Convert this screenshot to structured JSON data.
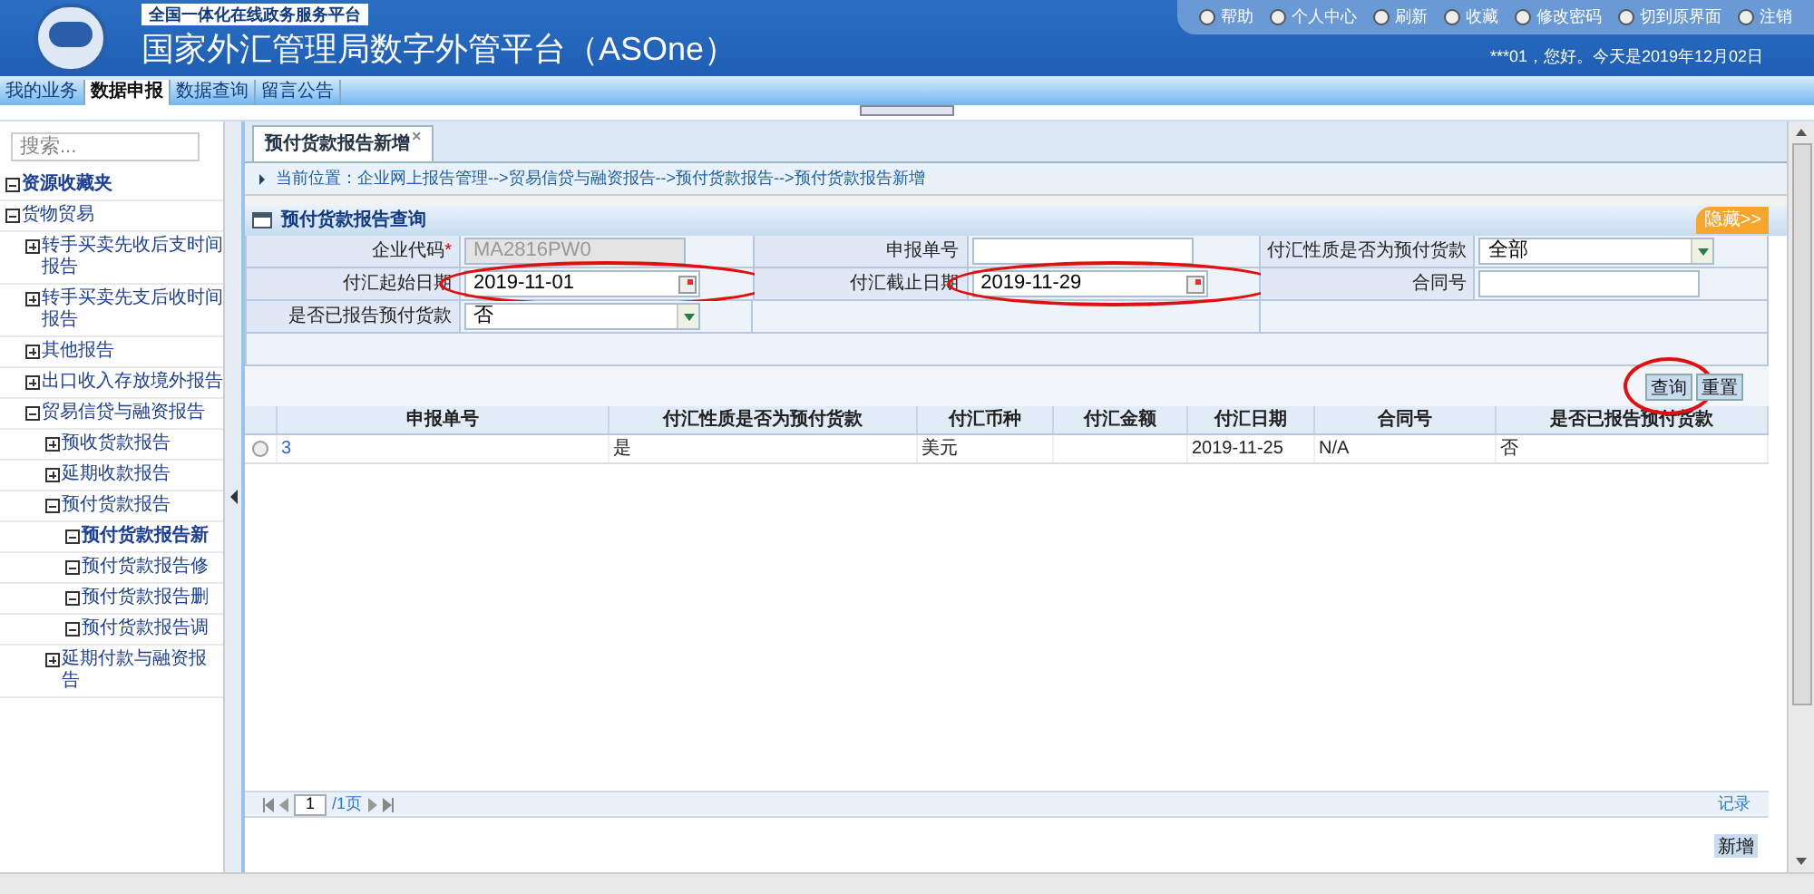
{
  "header": {
    "tagline": "全国一体化在线政务服务平台",
    "title": "国家外汇管理局数字外管平台（ASOne）",
    "links": [
      "帮助",
      "个人中心",
      "刷新",
      "收藏",
      "修改密码",
      "切到原界面",
      "注销"
    ],
    "greeting": "***01，您好。今天是2019年12月02日"
  },
  "menu": [
    {
      "label": "我的业务",
      "selected": false
    },
    {
      "label": "数据申报",
      "selected": true
    },
    {
      "label": "数据查询",
      "selected": false
    },
    {
      "label": "留言公告",
      "selected": false
    }
  ],
  "sidebar": {
    "search": {
      "placeholder": "搜索..."
    },
    "tree": [
      {
        "label": "资源收藏夹",
        "expanded": true,
        "bold": true
      },
      {
        "label": "货物贸易",
        "expanded": true,
        "children": [
          {
            "label": "转手买卖先收后支时间报告",
            "expanded": false
          },
          {
            "label": "转手买卖先支后收时间报告",
            "expanded": false
          },
          {
            "label": "其他报告",
            "expanded": false
          },
          {
            "label": "出口收入存放境外报告",
            "expanded": false
          },
          {
            "label": "贸易信贷与融资报告",
            "expanded": true,
            "children": [
              {
                "label": "预收货款报告",
                "expanded": false
              },
              {
                "label": "延期收款报告",
                "expanded": false
              },
              {
                "label": "预付货款报告",
                "expanded": true,
                "children": [
                  {
                    "label": "预付货款报告新",
                    "expanded": true,
                    "bold": true
                  },
                  {
                    "label": "预付货款报告修",
                    "expanded": true
                  },
                  {
                    "label": "预付货款报告删",
                    "expanded": true
                  },
                  {
                    "label": "预付货款报告调",
                    "expanded": true
                  }
                ]
              },
              {
                "label": "延期付款与融资报告",
                "expanded": false
              }
            ]
          }
        ]
      }
    ]
  },
  "tabs": [
    {
      "label": "预付货款报告新增",
      "selected": true,
      "close": "×"
    }
  ],
  "breadcrumb": "当前位置：企业网上报告管理-->贸易信贷与融资报告-->预付货款报告-->预付货款报告新增",
  "panel": {
    "title": "预付货款报告查询",
    "hide": "隐藏>>",
    "fields": [
      {
        "label": "企业代码",
        "required": "*",
        "value": "MA2816PW0",
        "kind": "text",
        "disabled": true,
        "circled": false
      },
      {
        "label": "申报单号",
        "kind": "text",
        "disabled": false,
        "circled": false
      },
      {
        "label": "付汇性质是否为预付货款",
        "value": "全部",
        "kind": "select",
        "disabled": false,
        "circled": false
      },
      {
        "label": "付汇起始日期",
        "value": "2019-11-01",
        "kind": "date",
        "disabled": false,
        "circled": true
      },
      {
        "label": "付汇截止日期",
        "value": "2019-11-29",
        "kind": "date",
        "disabled": false,
        "circled": true
      },
      {
        "label": "合同号",
        "kind": "text",
        "disabled": false,
        "circled": false
      },
      {
        "label": "是否已报告预付货款",
        "value": "否",
        "kind": "select",
        "disabled": false,
        "circled": false
      }
    ],
    "buttons": [
      {
        "label": "查询",
        "circled": true
      },
      {
        "label": "重置",
        "circled": false
      }
    ]
  },
  "table": {
    "columns": [
      "申报单号",
      "付汇性质是否为预付货款",
      "付汇币种",
      "付汇金额",
      "付汇日期",
      "合同号",
      "是否已报告预付货款"
    ],
    "rows": [
      {
        "selected": false,
        "cells": [
          "3",
          "是",
          "美元",
          null,
          "2019-11-25",
          "N/A",
          "否"
        ]
      }
    ]
  },
  "pager": {
    "page": "1",
    "total": "/1页",
    "records": "记录"
  },
  "add_button": "新增"
}
